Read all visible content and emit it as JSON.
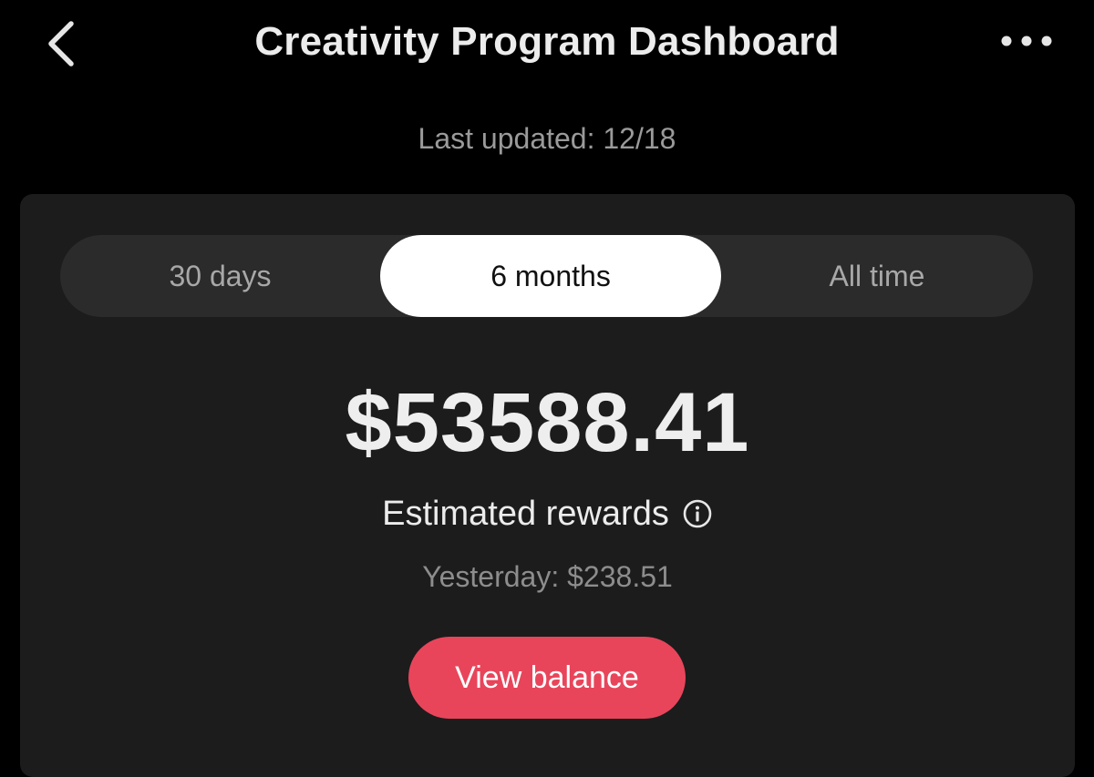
{
  "header": {
    "title": "Creativity Program Dashboard",
    "back_icon": "chevron-left-icon",
    "more_icon": "more-horizontal-icon"
  },
  "last_updated": "Last updated: 12/18",
  "tabs": [
    {
      "label": "30 days",
      "selected": false
    },
    {
      "label": "6 months",
      "selected": true
    },
    {
      "label": "All time",
      "selected": false
    }
  ],
  "rewards": {
    "amount": "$53588.41",
    "label": "Estimated rewards",
    "info_icon": "info-icon",
    "yesterday": "Yesterday: $238.51"
  },
  "actions": {
    "view_balance_label": "View balance"
  },
  "colors": {
    "background": "#000000",
    "card": "#1c1c1c",
    "segmented_track": "#2b2b2b",
    "selected_tab": "#ffffff",
    "accent": "#e8455b"
  }
}
